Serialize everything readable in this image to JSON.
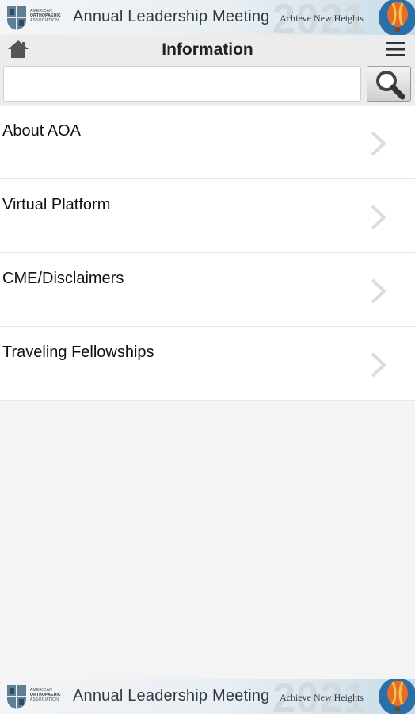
{
  "banner": {
    "association_lines": [
      "AMERICAN",
      "ORTHOPAEDIC",
      "ASSOCIATION"
    ],
    "title": "Annual Leadership Meeting",
    "year": "2021",
    "tagline": "Achieve New Heights"
  },
  "header": {
    "title": "Information"
  },
  "search": {
    "value": "",
    "placeholder": ""
  },
  "list": {
    "items": [
      {
        "label": "About AOA"
      },
      {
        "label": "Virtual Platform"
      },
      {
        "label": "CME/Disclaimers"
      },
      {
        "label": "Traveling Fellowships"
      }
    ]
  },
  "colors": {
    "header_bg": "#ececec",
    "page_bg": "#f4f4f4",
    "balloon": "#e86b2a"
  }
}
